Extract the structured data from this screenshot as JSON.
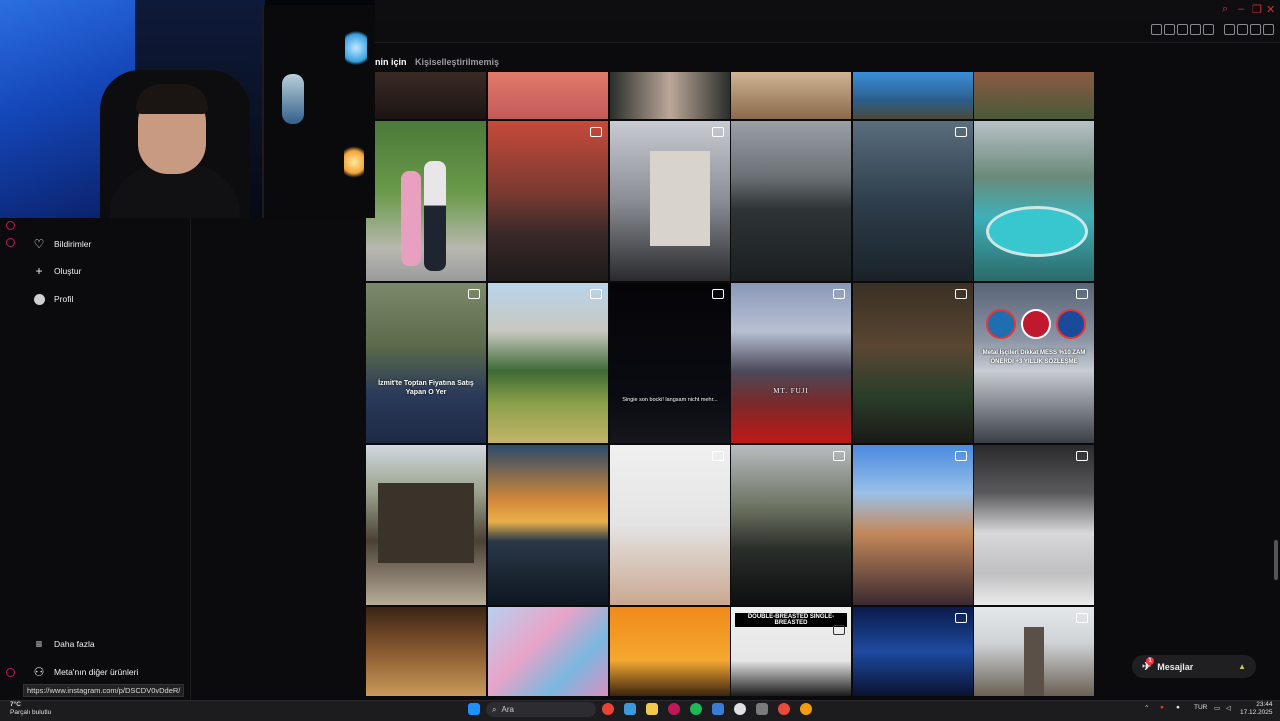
{
  "header": {
    "tab_active": "nin için",
    "tab_inactive": "Kişiselleştirilmemiş"
  },
  "sidebar": {
    "items": [
      {
        "label": "Bildirimler",
        "icon": "heart-icon"
      },
      {
        "label": "Oluştur",
        "icon": "plus-icon"
      },
      {
        "label": "Profil",
        "icon": "avatar-icon"
      }
    ],
    "more": "Daha fazla",
    "meta": "Meta'nın diğer ürünleri"
  },
  "tiles": {
    "row2": [
      "couple photo",
      "street shops",
      "city timelapse",
      "dark mountain lake",
      "stormy sea tree",
      "cliff pool"
    ],
    "caption_izmit": "İzmit'te Toptan Fiyatına Satış Yapan O Yer",
    "caption_night": "Singie son bocki! langsam nicht mehr...",
    "caption_fuji": "MT. FUJI",
    "caption_metal": "Metal İşçileri Dikkat MESS %10 ZAM ÖNERDİ +3 YILLIK SÖZLEŞME",
    "caption_suit": "DOUBLE-BREASTED  SINGLE-BREASTED"
  },
  "messages": {
    "label": "Mesajlar",
    "count": "1"
  },
  "status_url": "https://www.instagram.com/p/DSCDV0vDdeR/",
  "taskbar": {
    "search_placeholder": "Ara",
    "weather_temp": "7°C",
    "weather_desc": "Parçalı bulutlu",
    "lang": "TUR",
    "time": "23:44",
    "date": "17.12.2025"
  },
  "colors": {
    "accent": "#c2185b",
    "notify": "#ff3040",
    "background": "#0b0b0d"
  }
}
